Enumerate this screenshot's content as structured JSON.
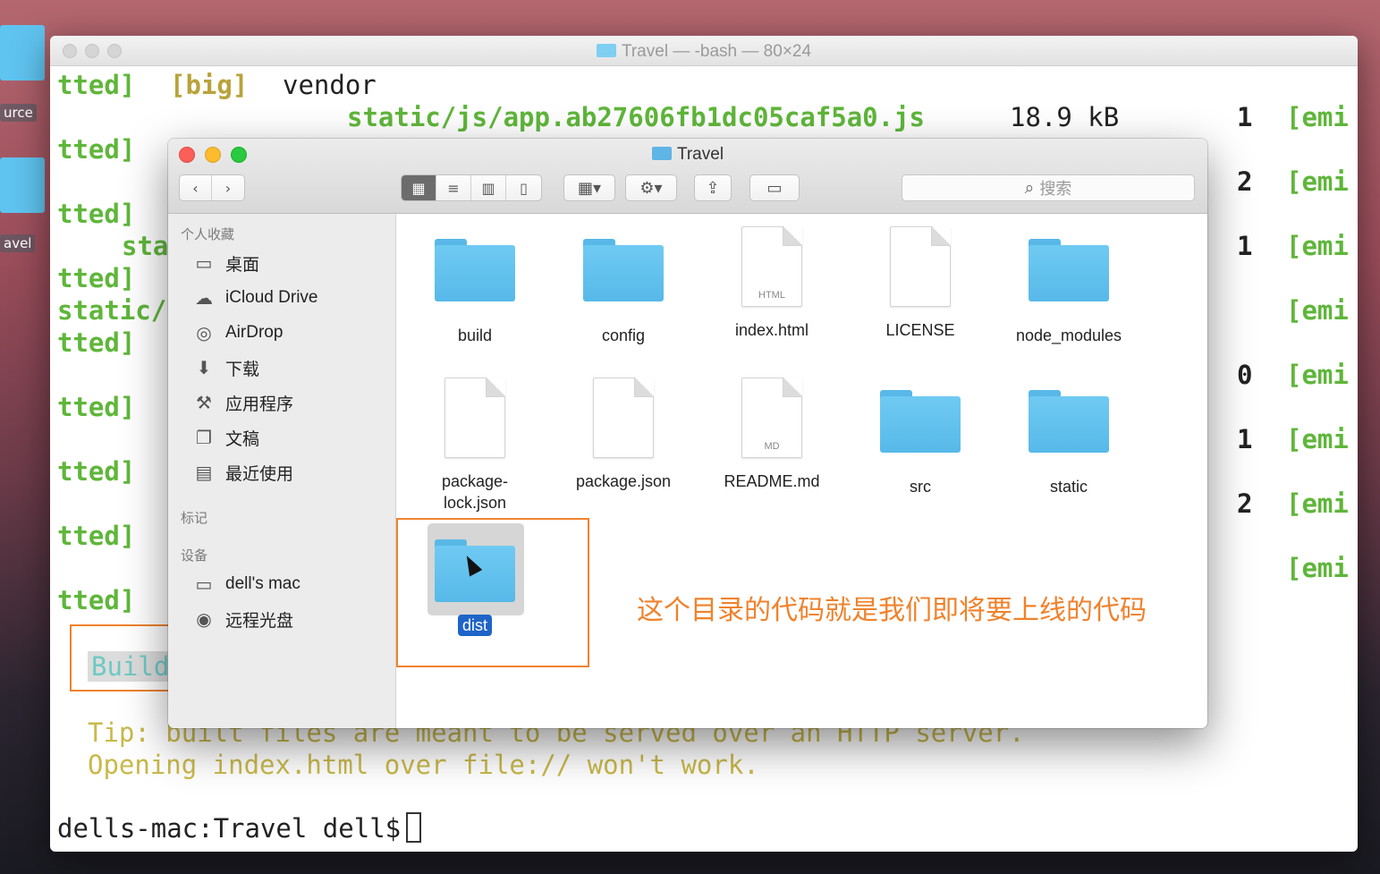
{
  "desktop": {
    "labels": [
      "urce",
      "avel"
    ]
  },
  "terminal": {
    "title": "Travel — -bash — 80×24",
    "lines": {
      "l1_a": "tted]",
      "l1_b": "[big]",
      "l1_c": "vendor",
      "l2_file": "static/js/app.ab27606fb1dc05caf5a0.js",
      "l2_size": "18.9 kB",
      "l2_n": "1",
      "l2_emi": "[emi",
      "l3_a": "tted]",
      "l3_n": "2",
      "l3_emi": "[emi",
      "l4_a": "tted]",
      "l5_a": "sta",
      "l5_n": "1",
      "l5_emi": "[emi",
      "l6_a": "tted]",
      "l7_a": "static/",
      "l7_emi": "[emi",
      "l8_a": "tted]",
      "l8_n": "0",
      "l8_emi": "[emi",
      "l9_a": "tted]",
      "l9_n": "1",
      "l9_emi": "[emi",
      "l10_a": "tted]",
      "l10_n": "2",
      "l10_emi": "[emi",
      "l11_a": "tted]",
      "l11_emi": "[emi",
      "l12_a": "tted]",
      "build": "Build",
      "tip1": "Tip: built files are meant to be served over an HTTP server.",
      "tip2": "Opening index.html over file:// won't work.",
      "prompt": "dells-mac:Travel dell$"
    }
  },
  "finder": {
    "title": "Travel",
    "search_placeholder": "搜索",
    "sidebar": {
      "favorites_header": "个人收藏",
      "favorites": [
        {
          "label": "桌面",
          "icon": "desktop-icon"
        },
        {
          "label": "iCloud Drive",
          "icon": "cloud-icon"
        },
        {
          "label": "AirDrop",
          "icon": "airdrop-icon"
        },
        {
          "label": "下载",
          "icon": "download-icon"
        },
        {
          "label": "应用程序",
          "icon": "applications-icon"
        },
        {
          "label": "文稿",
          "icon": "documents-icon"
        },
        {
          "label": "最近使用",
          "icon": "recents-icon"
        }
      ],
      "tags_header": "标记",
      "devices_header": "设备",
      "devices": [
        {
          "label": "dell's mac",
          "icon": "computer-icon"
        },
        {
          "label": "远程光盘",
          "icon": "disc-icon"
        }
      ]
    },
    "files": [
      {
        "name": "build",
        "type": "folder"
      },
      {
        "name": "config",
        "type": "folder"
      },
      {
        "name": "index.html",
        "type": "doc",
        "tag": "HTML"
      },
      {
        "name": "LICENSE",
        "type": "doc",
        "tag": ""
      },
      {
        "name": "node_modules",
        "type": "folder"
      },
      {
        "name": "package-\nlock.json",
        "type": "doc",
        "tag": ""
      },
      {
        "name": "package.json",
        "type": "doc",
        "tag": ""
      },
      {
        "name": "README.md",
        "type": "doc",
        "tag": "MD"
      },
      {
        "name": "src",
        "type": "folder"
      },
      {
        "name": "static",
        "type": "folder"
      },
      {
        "name": "dist",
        "type": "folder",
        "selected": true
      }
    ]
  },
  "annotation": {
    "text": "这个目录的代码就是我们即将要上线的代码",
    "color": "#f0822c"
  }
}
